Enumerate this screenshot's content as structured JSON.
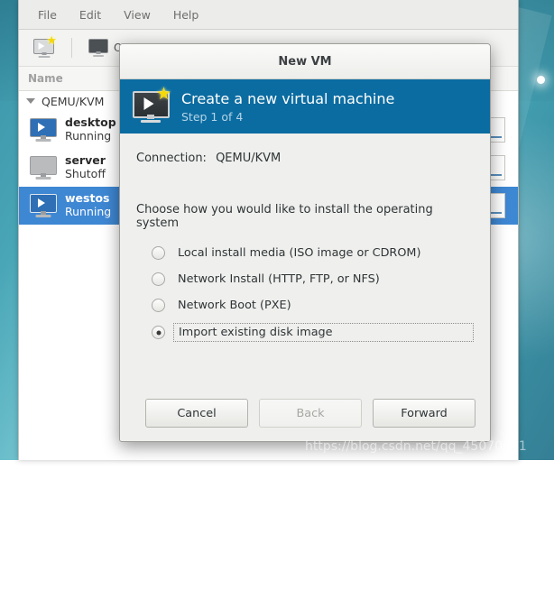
{
  "desktop": {
    "watermark": "https://blog.csdn.net/qq_45070541"
  },
  "main_window": {
    "menubar": [
      {
        "label": "File"
      },
      {
        "label": "Edit"
      },
      {
        "label": "View"
      },
      {
        "label": "Help"
      }
    ],
    "toolbar": {
      "new_vm_icon": "new-vm-monitor-icon",
      "open_label": "Open",
      "open_icon": "monitor-icon"
    },
    "list_header": {
      "name": "Name",
      "cpu": ""
    },
    "connection_group": {
      "label": "QEMU/KVM",
      "expanded": true
    },
    "vms": [
      {
        "name": "desktop",
        "state": "Running",
        "selected": false,
        "icon": "vm-running-icon"
      },
      {
        "name": "server",
        "state": "Shutoff",
        "selected": false,
        "icon": "vm-shutoff-icon"
      },
      {
        "name": "westos",
        "state": "Running",
        "selected": true,
        "icon": "vm-running-icon"
      }
    ]
  },
  "dialog": {
    "title": "New VM",
    "banner": {
      "icon": "new-vm-monitor-icon",
      "heading": "Create a new virtual machine",
      "step": "Step 1 of 4"
    },
    "connection_label": "Connection:",
    "connection_value": "QEMU/KVM",
    "prompt": "Choose how you would like to install the operating system",
    "options": [
      {
        "label": "Local install media (ISO image or CDROM)",
        "selected": false
      },
      {
        "label": "Network Install (HTTP, FTP, or NFS)",
        "selected": false
      },
      {
        "label": "Network Boot (PXE)",
        "selected": false
      },
      {
        "label": "Import existing disk image",
        "selected": true
      }
    ],
    "buttons": {
      "cancel": "Cancel",
      "back": "Back",
      "back_disabled": true,
      "forward": "Forward"
    }
  },
  "colors": {
    "banner_blue": "#0b6ca1",
    "selection_blue": "#3e87d3",
    "desktop_teal": "#49a6b6"
  }
}
